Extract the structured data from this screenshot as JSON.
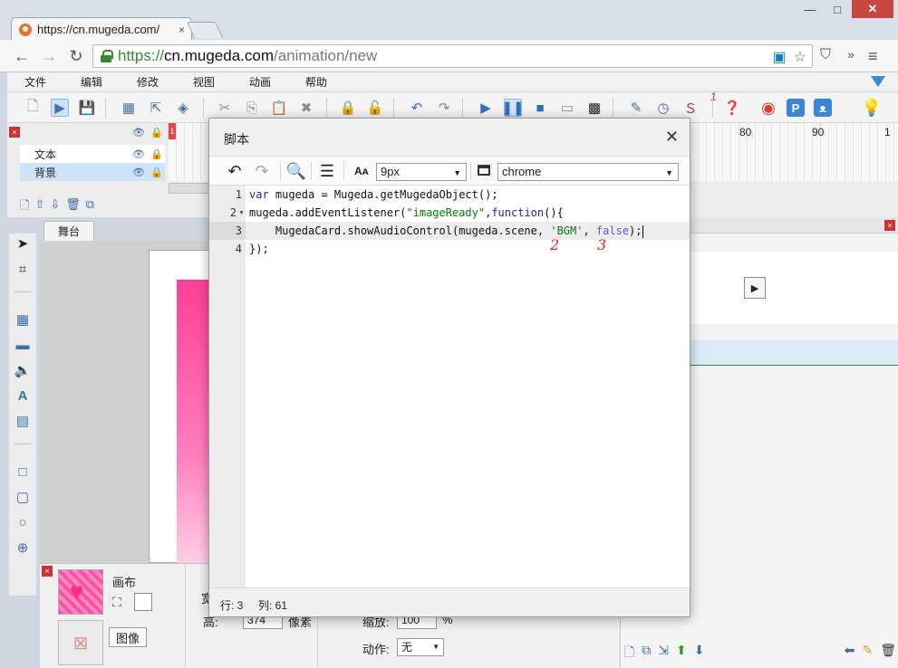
{
  "browser": {
    "tab_title": "https://cn.mugeda.com/",
    "tab_close": "×",
    "window_controls": {
      "minimize": "—",
      "maximize": "□",
      "close": "✕"
    },
    "url": {
      "scheme": "https://",
      "host": "cn.mugeda.com",
      "path": "/animation/new"
    },
    "nav": {
      "back": "←",
      "forward": "→",
      "reload": "↻"
    }
  },
  "app_menu": {
    "items": [
      "文件",
      "编辑",
      "修改",
      "视图",
      "动画",
      "帮助"
    ]
  },
  "toolbar": {
    "annotation_1": "1"
  },
  "timeline": {
    "layers": [
      {
        "name": "文本"
      },
      {
        "name": "背景"
      }
    ],
    "playhead_label": "1",
    "ruler_numbers": [
      "80",
      "90",
      "1"
    ]
  },
  "stage": {
    "tab_label": "舞台"
  },
  "properties": {
    "canvas_label": "画布",
    "image_button": "图像",
    "width_fragment": "宽",
    "height_label": "高:",
    "height_value": "374",
    "height_unit": "像素",
    "zoom_label": "缩放:",
    "zoom_value": "100",
    "zoom_unit": "%",
    "action_label": "动作:",
    "action_value": "无"
  },
  "script_dialog": {
    "title": "脚本",
    "close": "✕",
    "font_size_icon": "Aᴀ",
    "font_size": "9px",
    "theme": "chrome",
    "line_numbers": [
      "1",
      "2",
      "3",
      "4"
    ],
    "code": {
      "line1_kw": "var",
      "line1_rest": " mugeda = Mugeda.getMugedaObject();",
      "line2_a": "mugeda.addEventListener(",
      "line2_str": "\"imageReady\"",
      "line2_b": ",",
      "line2_kw": "function",
      "line2_c": "(){",
      "line3_a": "    MugedaCard.showAudioControl(mugeda.scene, ",
      "line3_str": "'BGM'",
      "line3_b": ", ",
      "line3_bool": "false",
      "line3_c": ");",
      "line4": "});"
    },
    "annotations": {
      "two": "2",
      "three": "3"
    },
    "status": {
      "row": "行: 3",
      "col": "列: 61"
    }
  }
}
